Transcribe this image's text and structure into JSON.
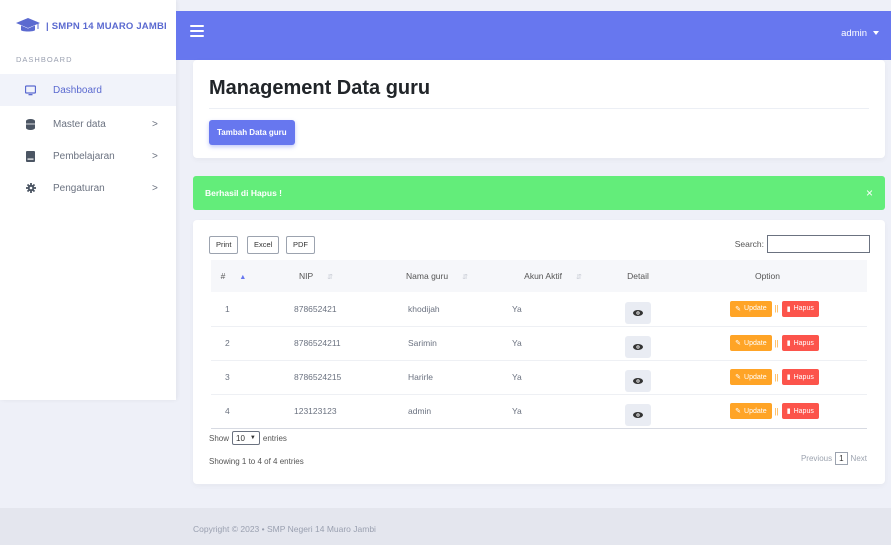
{
  "brand": {
    "name": "| SMPN 14 MUARO JAMBI",
    "icon": "graduation-cap-icon",
    "color": "#5b6ad0"
  },
  "sidebar": {
    "section_label": "DASHBOARD",
    "items": [
      {
        "label": "Dashboard",
        "icon": "monitor-icon",
        "active": true
      },
      {
        "label": "Master data",
        "icon": "database-icon",
        "chevron": ">"
      },
      {
        "label": "Pembelajaran",
        "icon": "book-icon",
        "chevron": ">"
      },
      {
        "label": "Pengaturan",
        "icon": "gear-icon",
        "chevron": ">"
      }
    ]
  },
  "topbar": {
    "user": "admin",
    "accent": "#6777ef"
  },
  "header": {
    "title": "Management Data guru",
    "add_button": "Tambah Data guru"
  },
  "alert": {
    "message": "Berhasil di Hapus !",
    "close": "×",
    "color": "#63ed7a"
  },
  "table": {
    "buttons": {
      "print": "Print",
      "excel": "Excel",
      "pdf": "PDF"
    },
    "search_label": "Search:",
    "columns": [
      "#",
      "NIP",
      "Nama guru",
      "Akun Aktif",
      "Detail",
      "Option"
    ],
    "rows": [
      {
        "no": "1",
        "nip": "878652421",
        "nama": "khodijah",
        "aktif": "Ya"
      },
      {
        "no": "2",
        "nip": "8786524211",
        "nama": "Sarimin",
        "aktif": "Ya"
      },
      {
        "no": "3",
        "nip": "8786524215",
        "nama": "Harirle",
        "aktif": "Ya"
      },
      {
        "no": "4",
        "nip": "123123123",
        "nama": "admin",
        "aktif": "Ya"
      }
    ],
    "update_label": "Update",
    "hapus_label": "Hapus",
    "show_prefix": "Show",
    "show_value": "10",
    "show_suffix": "entries",
    "info": "Showing 1 to 4 of 4 entries",
    "pager": {
      "previous": "Previous",
      "current": "1",
      "next": "Next"
    }
  },
  "footer": {
    "text": "Copyright © 2023  • SMP Negeri 14 Muaro Jambi"
  }
}
